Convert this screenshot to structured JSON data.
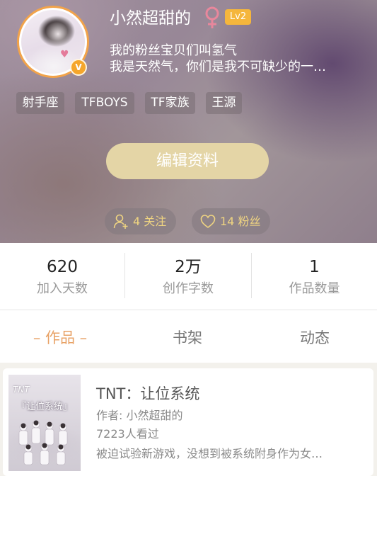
{
  "profile": {
    "nickname": "小然超甜的",
    "gender_icon": "female-symbol-icon",
    "level": "Lv2",
    "verified_badge": "V",
    "bio_line1": "我的粉丝宝贝们叫氢气",
    "bio_line2": "我是天然气，你们是我不可缺少的一…",
    "tags": [
      "射手座",
      "TFBOYS",
      "TF家族",
      "王源"
    ],
    "edit_button": "编辑资料",
    "following_label": "4 关注",
    "followers_label": "14 粉丝"
  },
  "stats": [
    {
      "value": "620",
      "label": "加入天数"
    },
    {
      "value": "2万",
      "label": "创作字数"
    },
    {
      "value": "1",
      "label": "作品数量"
    }
  ],
  "tabs": [
    {
      "label": "– 作品 –",
      "active": true
    },
    {
      "label": "书架",
      "active": false
    },
    {
      "label": "动态",
      "active": false
    }
  ],
  "works": [
    {
      "title": "TNT：让位系统",
      "author": "作者: 小然超甜的",
      "views": "7223人看过",
      "summary": "被迫试验新游戏，没想到被系统附身作为女…",
      "cover_title": "『让位系统』",
      "cover_logo": "TNT"
    }
  ],
  "colors": {
    "accent_orange": "#e8a266",
    "level_badge": "#f5b63c",
    "edit_button": "#e4d5a6",
    "pill_text": "#efd481",
    "gender_pink": "#e8879c"
  }
}
